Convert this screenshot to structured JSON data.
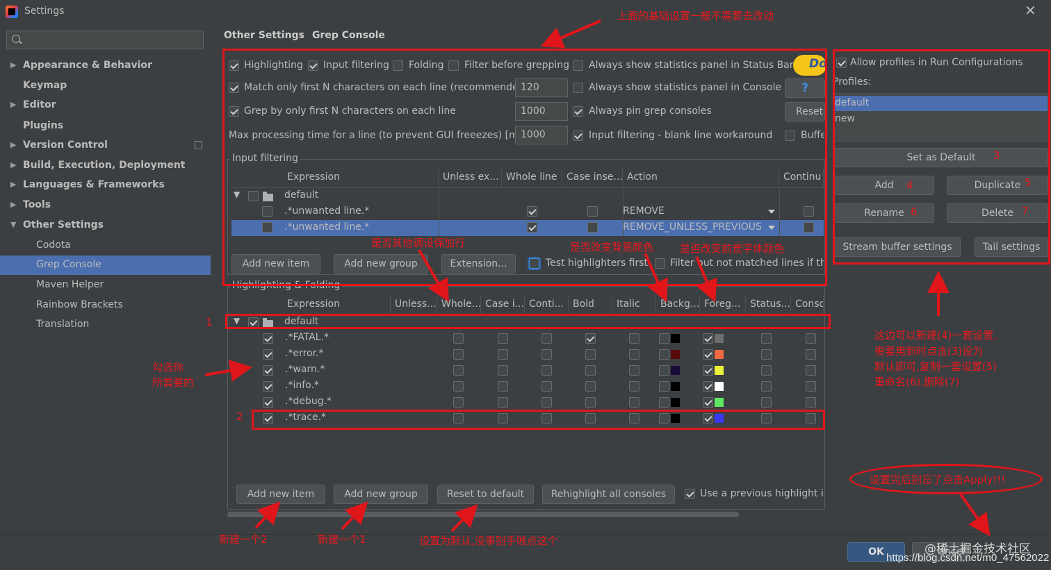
{
  "window": {
    "title": "Settings"
  },
  "sidebar": {
    "items": [
      {
        "label": "Appearance & Behavior"
      },
      {
        "label": "Keymap"
      },
      {
        "label": "Editor"
      },
      {
        "label": "Plugins"
      },
      {
        "label": "Version Control"
      },
      {
        "label": "Build, Execution, Deployment"
      },
      {
        "label": "Languages & Frameworks"
      },
      {
        "label": "Tools"
      },
      {
        "label": "Other Settings"
      },
      {
        "label": "Codota"
      },
      {
        "label": "Grep Console"
      },
      {
        "label": "Maven Helper"
      },
      {
        "label": "Rainbow Brackets"
      },
      {
        "label": "Translation"
      }
    ],
    "help": "?"
  },
  "breadcrumb": {
    "parent": "Other Settings",
    "sep": "›",
    "current": "Grep Console"
  },
  "options": {
    "highlighting": "Highlighting",
    "input_filtering": "Input filtering",
    "folding": "Folding",
    "filter_before": "Filter before grepping",
    "stats_status_bar": "Always show statistics panel in Status Bar",
    "match_first_n": "Match only first N characters on each line (recommended)",
    "match_first_n_value": "120",
    "stats_console": "Always show statistics panel in Console",
    "grep_first_n": "Grep by only first N characters on each line",
    "grep_first_n_value": "1000",
    "pin_consoles": "Always pin grep consoles",
    "max_time": "Max processing time for a line (to prevent GUI freeezes) [ms]",
    "max_time_value": "1000",
    "blank_line": "Input filtering - blank line workaround",
    "buffer": "Buffe",
    "donate": "Do",
    "help_q": "?",
    "reset": "Reset"
  },
  "input_filtering": {
    "title": "Input filtering",
    "headers": [
      "Expression",
      "Unless ex...",
      "Whole line",
      "Case inse...",
      "Action",
      "Continu"
    ],
    "group": "default",
    "rows": [
      {
        "expr": ".*unwanted line.*",
        "action": "REMOVE"
      },
      {
        "expr": ".*unwanted line.*",
        "action": "REMOVE_UNLESS_PREVIOUS..."
      }
    ],
    "buttons": {
      "add_item": "Add new item",
      "add_group": "Add new group",
      "extension": "Extension..."
    },
    "test_highlighters": "Test highlighters first",
    "filter_out": "Filter out not matched lines if the"
  },
  "highlighting": {
    "title": "Highlighting & Folding",
    "headers": [
      "Expression",
      "Unless...",
      "Whole...",
      "Case i...",
      "Conti...",
      "Bold",
      "Italic",
      "Backg...",
      "Foreg...",
      "Status...",
      "Conso"
    ],
    "group": "default",
    "rows": [
      {
        "expr": ".*FATAL.*",
        "fg": "#6e6e6e",
        "bold": true
      },
      {
        "expr": ".*error.*",
        "fg": "#f06a3f",
        "bg": "#5a0a0a"
      },
      {
        "expr": ".*warn.*",
        "fg": "#e8f03a",
        "bg": "#1a0a3a"
      },
      {
        "expr": ".*info.*",
        "fg": "#ffffff"
      },
      {
        "expr": ".*debug.*",
        "fg": "#5fe85f"
      },
      {
        "expr": ".*trace.*",
        "fg": "#3a3af5"
      }
    ],
    "buttons": {
      "add_item": "Add new item",
      "add_group": "Add new group",
      "reset": "Reset to default",
      "rehighlight": "Rehighlight all consoles"
    },
    "use_previous": "Use a previous highlight if"
  },
  "profiles": {
    "allow": "Allow profiles in Run Configurations",
    "label": "Profiles:",
    "items": [
      "default",
      "new"
    ],
    "buttons": {
      "set_default": "Set as Default",
      "add": "Add",
      "duplicate": "Duplicate",
      "rename": "Rename",
      "delete": "Delete",
      "stream": "Stream buffer settings",
      "tail": "Tail settings"
    }
  },
  "footer": {
    "ok": "OK",
    "cancel": "ancel"
  },
  "annotations": {
    "top": "上面的基础设置一般不需要去改动",
    "input_filter_add": "是否其他调设保加行",
    "bg_color": "是否改变背景颜色",
    "fg_color": "是否改变前景字体颜色",
    "check_left_1": "勾选你",
    "check_left_2": "所需要的",
    "right_1": "这边可以新建(4)一套设置,",
    "right_2": "需要用到时点击(3)设为",
    "right_3": "默认即可,复制一套设置(5)",
    "right_4": "重命名(6),删除(7)",
    "apply": "设置完后别忘了点击Apply!!!",
    "new_2": "新建一个2",
    "new_1": "新建一个1",
    "reset_default": "设置为默认,没事别手贱点这个",
    "n1": "1",
    "n2": "2",
    "n3": "3",
    "n4": "4",
    "n5": "5",
    "n6": "6",
    "n7": "7"
  },
  "watermark": {
    "line1": "@稀土掘金技术社区",
    "line2": "https://blog.csdn.net/m0_47562022"
  },
  "colors": {
    "accent_red": "#e0161b",
    "selection": "#4b6eaf",
    "bg": "#3c3f41"
  }
}
